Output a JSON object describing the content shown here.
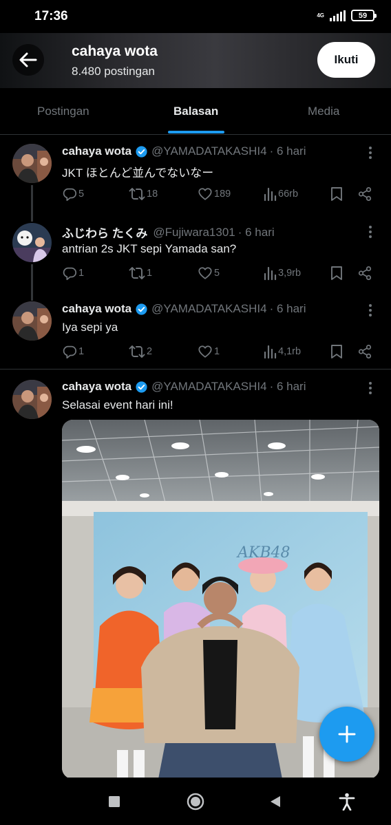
{
  "status_bar": {
    "time": "17:36",
    "network": "4G",
    "battery": "59"
  },
  "header": {
    "name": "cahaya wota",
    "post_count": "8.480 postingan",
    "follow_label": "Ikuti"
  },
  "tabs": [
    {
      "label": "Postingan"
    },
    {
      "label": "Balasan"
    },
    {
      "label": "Media"
    }
  ],
  "active_tab": "Balasan",
  "posts": [
    {
      "name": "cahaya wota",
      "verified": true,
      "handle": "@YAMADATAKASHI4",
      "time": "· 6 hari",
      "text": "JKT ほとんど並んでないなー",
      "replies": "5",
      "reposts": "18",
      "likes": "189",
      "views": "66rb"
    },
    {
      "name": "ふじわら たくみ",
      "verified": false,
      "handle": "@Fujiwara1301",
      "time": "· 6 hari",
      "text": "antrian 2s JKT sepi Yamada san?",
      "replies": "1",
      "reposts": "1",
      "likes": "5",
      "views": "3,9rb"
    },
    {
      "name": "cahaya wota",
      "verified": true,
      "handle": "@YAMADATAKASHI4",
      "time": "· 6 hari",
      "text": "Iya sepi ya",
      "replies": "1",
      "reposts": "2",
      "likes": "1",
      "views": "4,1rb"
    },
    {
      "name": "cahaya wota",
      "verified": true,
      "handle": "@YAMADATAKASHI4",
      "time": "· 6 hari",
      "text": "Selasai event hari ini!"
    }
  ],
  "colors": {
    "accent": "#1d9bf0",
    "muted": "#71767b",
    "text": "#e7e9ea",
    "divider": "#2f3336"
  },
  "icons": [
    "back-arrow-icon",
    "verified-icon",
    "more-icon",
    "reply-icon",
    "repost-icon",
    "like-icon",
    "views-icon",
    "bookmark-icon",
    "share-icon",
    "plus-icon",
    "home-circle-icon",
    "recents-square-icon",
    "back-triangle-icon",
    "accessibility-icon"
  ]
}
